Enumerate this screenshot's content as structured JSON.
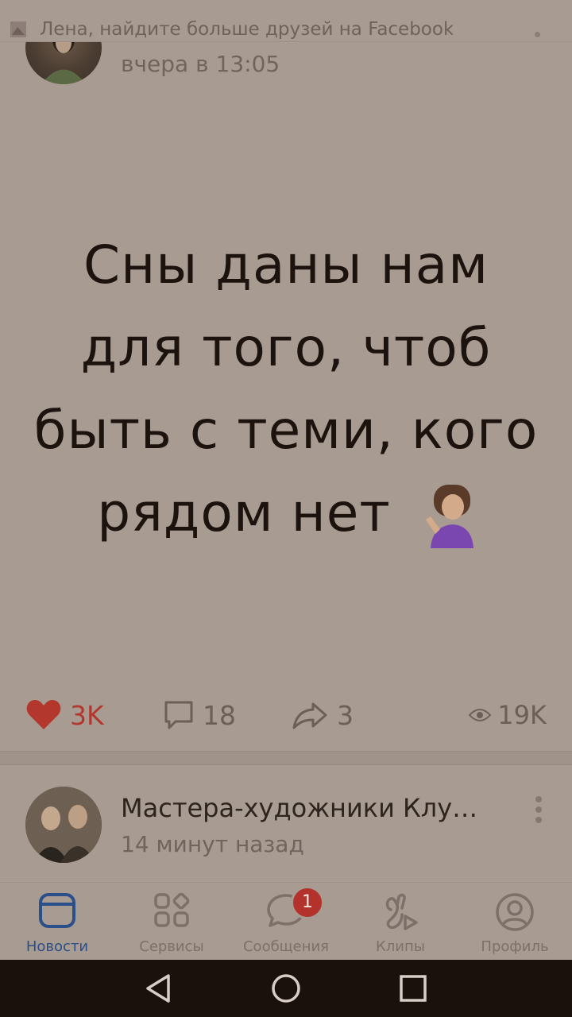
{
  "notification": {
    "text": "Лена, найдите больше друзей на Facebook"
  },
  "post1": {
    "time": "вчера в 13:05",
    "quote_lines": [
      "Сны даны нам",
      "для того, чтоб",
      "быть с теми, кого",
      "рядом нет"
    ],
    "likes": "3K",
    "comments": "18",
    "shares": "3",
    "views": "19K"
  },
  "post2": {
    "title": "Мастера-художники Клуб...",
    "time": "14 минут назад"
  },
  "tabs": [
    {
      "label": "Новости",
      "icon": "news-icon",
      "active": true
    },
    {
      "label": "Сервисы",
      "icon": "services-icon"
    },
    {
      "label": "Сообщения",
      "icon": "messages-icon",
      "badge": "1"
    },
    {
      "label": "Клипы",
      "icon": "clips-icon"
    },
    {
      "label": "Профиль",
      "icon": "profile-icon"
    }
  ],
  "colors": {
    "accent": "#2b4f88",
    "like": "#b4372e",
    "badge": "#b3322b",
    "background": "#a89b92"
  }
}
